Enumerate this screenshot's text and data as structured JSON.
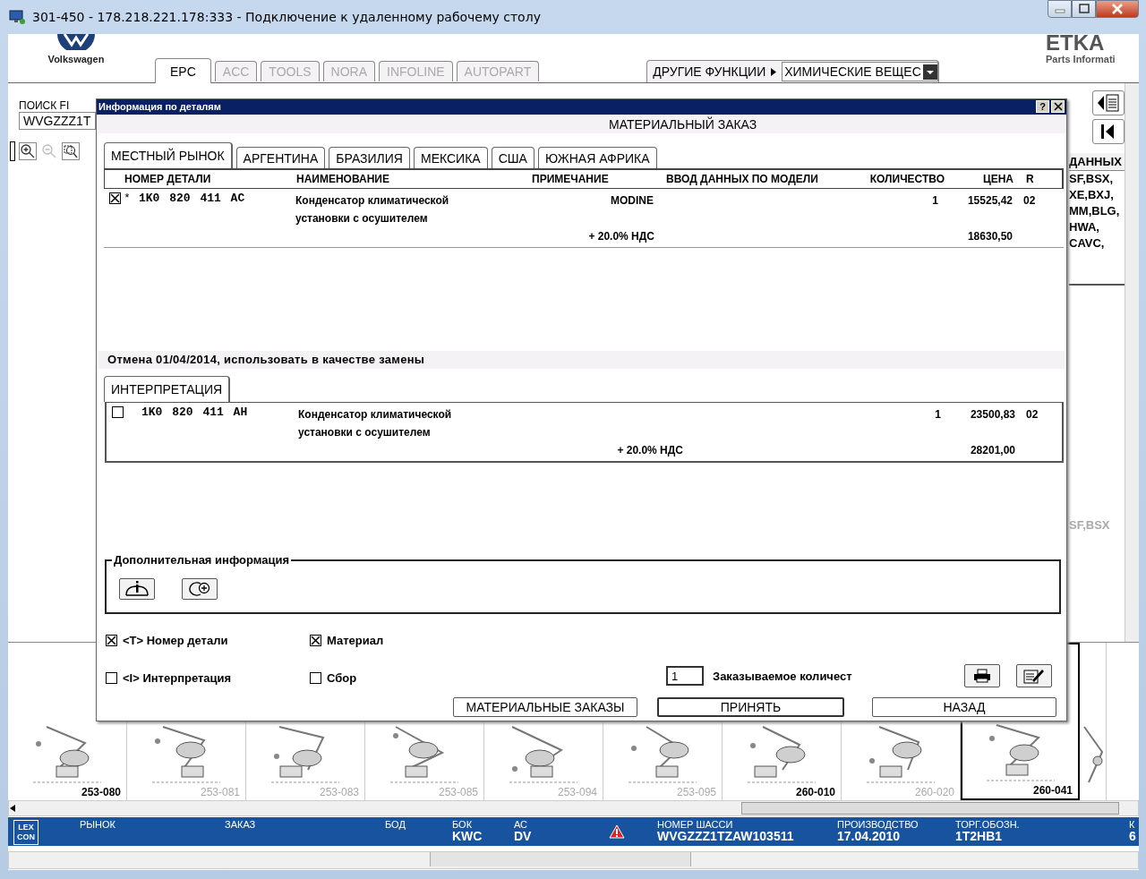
{
  "window": {
    "title": "301-450 - 178.218.221.178:333 - Подключение к удаленному рабочему столу"
  },
  "header": {
    "make": "Volkswagen",
    "brand": "ETKA",
    "brand_subtitle": "Parts Informati"
  },
  "app_tabs": [
    {
      "label": "EPC",
      "selected": true
    },
    {
      "label": "ACC",
      "selected": false
    },
    {
      "label": "TOOLS",
      "selected": false
    },
    {
      "label": "NORA",
      "selected": false
    },
    {
      "label": "INFOLINE",
      "selected": false
    },
    {
      "label": "AUTOPART",
      "selected": false
    }
  ],
  "functions": {
    "label": "ДРУГИЕ ФУНКЦИИ",
    "value": "ХИМИЧЕСКИЕ ВЕЩЕС"
  },
  "search": {
    "label": "ПОИСК FI",
    "value": "WVGZZZ1T"
  },
  "side_panel": {
    "header": "ДАННЫХ",
    "lines": [
      "SF,BSX,",
      "XE,BXJ,",
      "MM,BLG,",
      "HWA,",
      "CAVC,"
    ],
    "footer": "SF,BSX"
  },
  "thumbnails": [
    {
      "label": "253-080",
      "available": true,
      "selected": false
    },
    {
      "label": "253-081",
      "available": false,
      "selected": false
    },
    {
      "label": "253-083",
      "available": false,
      "selected": false
    },
    {
      "label": "253-085",
      "available": false,
      "selected": false
    },
    {
      "label": "253-094",
      "available": false,
      "selected": false
    },
    {
      "label": "253-095",
      "available": false,
      "selected": false
    },
    {
      "label": "260-010",
      "available": true,
      "selected": false
    },
    {
      "label": "260-020",
      "available": false,
      "selected": false
    },
    {
      "label": "260-041",
      "available": true,
      "selected": true
    }
  ],
  "status_bar": {
    "logo": [
      "LEX",
      "CON"
    ],
    "fields": [
      {
        "label": "РЫНОК"
      },
      {
        "label": "ЗАКАЗ"
      },
      {
        "label": "БОД"
      },
      {
        "label": "БОК",
        "value": "KWC"
      },
      {
        "label": "АС",
        "value": "DV"
      },
      {
        "label": "НОМЕР ШАССИ",
        "value": "WVGZZZ1TZAW103511",
        "warning": true
      },
      {
        "label": "ПРОИЗВОДСТВО",
        "value": "17.04.2010"
      },
      {
        "label": "ТОРГ.ОБОЗН.",
        "value": "1T2HB1"
      },
      {
        "label": "К",
        "value": "6"
      }
    ]
  },
  "dialog": {
    "title": "Информация по деталям",
    "help": "?",
    "subtitle": "МАТЕРИАЛЬНЫЙ ЗАКАЗ",
    "markets": [
      {
        "label": "МЕСТНЫЙ РЫНОК",
        "selected": true
      },
      {
        "label": "АРГЕНТИНА",
        "selected": false
      },
      {
        "label": "БРАЗИЛИЯ",
        "selected": false
      },
      {
        "label": "МЕКСИКА",
        "selected": false
      },
      {
        "label": "США",
        "selected": false
      },
      {
        "label": "ЮЖНАЯ АФРИКА",
        "selected": false
      }
    ],
    "columns": [
      "НОМЕР ДЕТАЛИ",
      "НАИМЕНОВАНИЕ",
      "ПРИМЕЧАНИЕ",
      "ВВОД ДАННЫХ ПО МОДЕЛИ",
      "КОЛИЧЕСТВО",
      "ЦЕНА",
      "R"
    ],
    "rows": [
      {
        "checked": true,
        "marker": "*",
        "part_no": "1K0 820 411 AC",
        "name": "Конденсатор климатической установки с осушителем",
        "note": "MODINE",
        "qty": "1",
        "price": "15525,42",
        "r": "02",
        "vat_label": "+ 20.0% НДС",
        "vat_price": "18630,50"
      }
    ],
    "replacement_note": "Отмена 01/04/2014, использовать в качестве замены",
    "interpretation_tab": "ИНТЕРПРЕТАЦИЯ",
    "interpretation_rows": [
      {
        "checked": false,
        "part_no": "1K0 820 411 AH",
        "name": "Конденсатор климатической установки с осушителем",
        "qty": "1",
        "price": "23500,83",
        "r": "02",
        "vat_label": "+ 20.0% НДС",
        "vat_price": "28201,00"
      }
    ],
    "extra_info": "Дополнительная информация",
    "options": [
      {
        "label": "<T> Номер детали",
        "checked": true
      },
      {
        "label": "Материал",
        "checked": true
      },
      {
        "label": "<I> Интерпретация",
        "checked": false
      },
      {
        "label": "Сбор",
        "checked": false
      }
    ],
    "quantity": {
      "value": "1",
      "label": "Заказываемое количест"
    },
    "buttons": [
      {
        "label": "МАТЕРИАЛЬНЫЕ ЗАКАЗЫ",
        "default": false
      },
      {
        "label": "ПРИНЯТЬ",
        "default": true
      },
      {
        "label": "НАЗАД",
        "default": false
      }
    ]
  }
}
